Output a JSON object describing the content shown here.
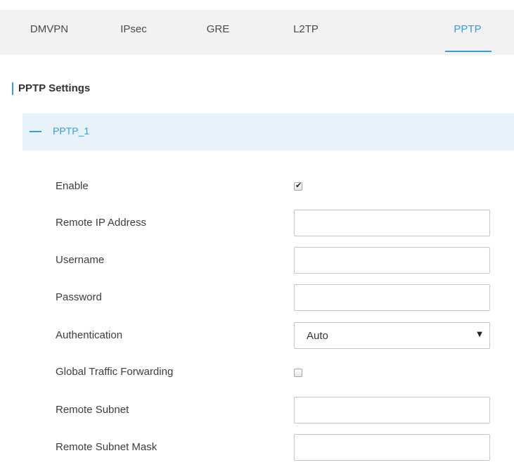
{
  "tabs": [
    {
      "label": "DMVPN",
      "active": false
    },
    {
      "label": "IPsec",
      "active": false
    },
    {
      "label": "GRE",
      "active": false
    },
    {
      "label": "L2TP",
      "active": false
    },
    {
      "label": "PPTP",
      "active": true
    }
  ],
  "section": {
    "title": "PPTP Settings"
  },
  "panel": {
    "title": "PPTP_1",
    "collapse_icon": "minus-icon"
  },
  "form": {
    "enable": {
      "label": "Enable",
      "checked": true
    },
    "remote_ip": {
      "label": "Remote IP Address",
      "value": "",
      "placeholder": ""
    },
    "username": {
      "label": "Username",
      "value": "",
      "placeholder": ""
    },
    "password": {
      "label": "Password",
      "value": "",
      "placeholder": ""
    },
    "authentication": {
      "label": "Authentication",
      "value": "Auto"
    },
    "global_traffic": {
      "label": "Global Traffic Forwarding",
      "checked": false
    },
    "remote_subnet": {
      "label": "Remote Subnet",
      "value": "",
      "placeholder": ""
    },
    "remote_subnet_mask": {
      "label": "Remote Subnet Mask",
      "value": "",
      "placeholder": ""
    }
  },
  "colors": {
    "accent": "#3a9bd8",
    "tab_bar_bg": "#f2f2f2",
    "panel_header_bg": "#e8f2fa",
    "field_border": "#c6c6c6"
  },
  "icons": {
    "checkmark": "checkmark-icon",
    "caret": "caret-down-icon"
  }
}
